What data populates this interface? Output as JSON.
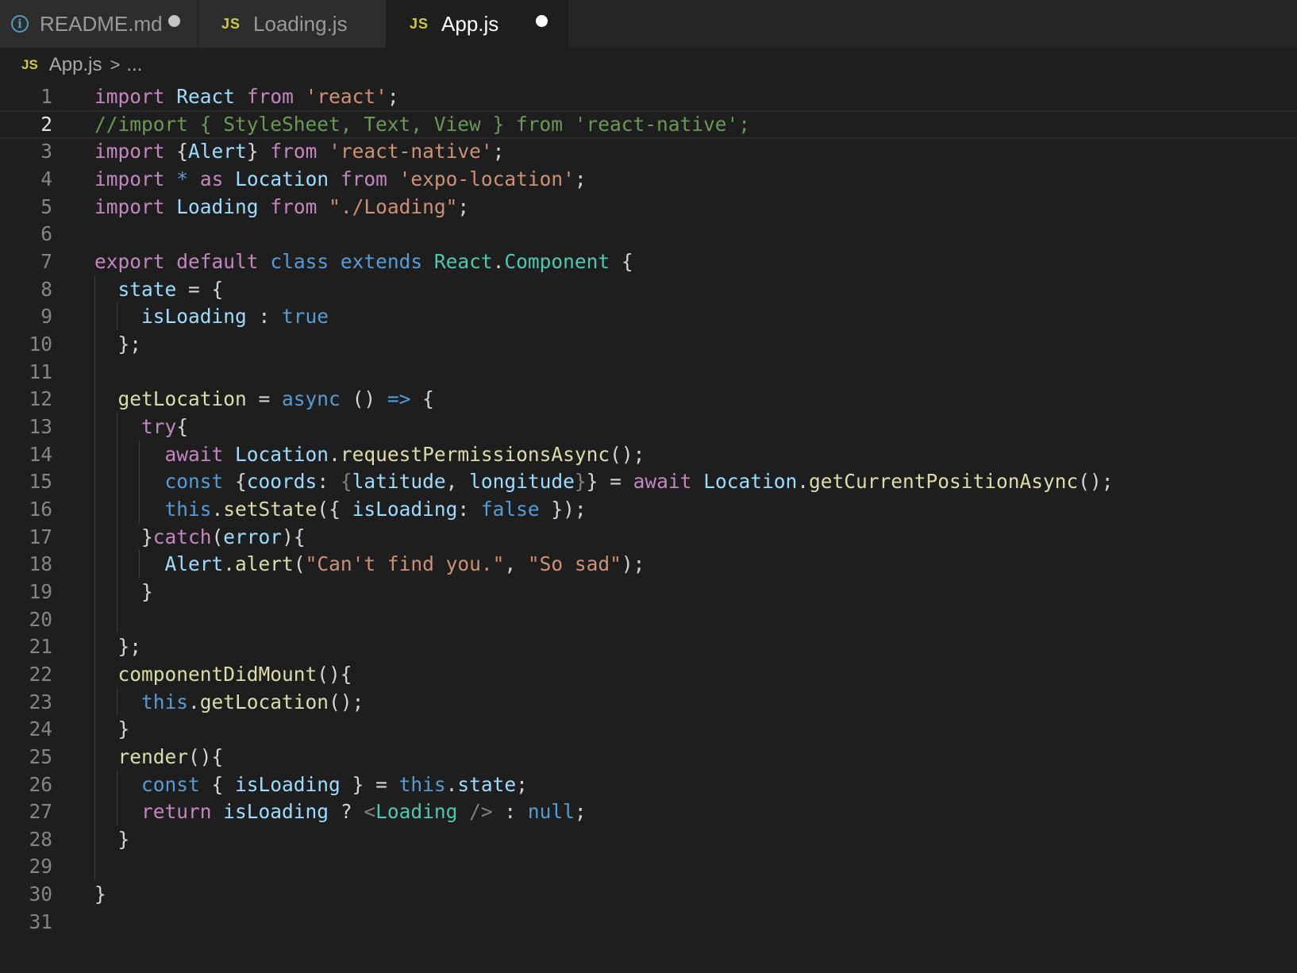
{
  "tabs": [
    {
      "label": "README.md",
      "icon": "info-icon",
      "dirty": true,
      "active": false
    },
    {
      "label": "Loading.js",
      "icon": "JS",
      "dirty": false,
      "active": false
    },
    {
      "label": "App.js",
      "icon": "JS",
      "dirty": true,
      "active": true
    }
  ],
  "breadcrumb": {
    "icon": "JS",
    "file": "App.js",
    "separator": ">",
    "rest": "..."
  },
  "editor": {
    "current_line": 2,
    "line_numbers": [
      "1",
      "2",
      "3",
      "4",
      "5",
      "6",
      "7",
      "8",
      "9",
      "10",
      "11",
      "12",
      "13",
      "14",
      "15",
      "16",
      "17",
      "18",
      "19",
      "20",
      "21",
      "22",
      "23",
      "24",
      "25",
      "26",
      "27",
      "28",
      "29",
      "30",
      "31"
    ],
    "lines": [
      [
        [
          "k",
          "import"
        ],
        [
          "p",
          " "
        ],
        [
          "v",
          "React"
        ],
        [
          "p",
          " "
        ],
        [
          "k",
          "from"
        ],
        [
          "p",
          " "
        ],
        [
          "s",
          "'react'"
        ],
        [
          "p",
          ";"
        ]
      ],
      [
        [
          "c",
          "//import { StyleSheet, Text, View } from 'react-native';"
        ]
      ],
      [
        [
          "k",
          "import"
        ],
        [
          "p",
          " {"
        ],
        [
          "v",
          "Alert"
        ],
        [
          "p",
          "} "
        ],
        [
          "k",
          "from"
        ],
        [
          "p",
          " "
        ],
        [
          "s",
          "'react-native'"
        ],
        [
          "p",
          ";"
        ]
      ],
      [
        [
          "k",
          "import"
        ],
        [
          "p",
          " "
        ],
        [
          "b",
          "*"
        ],
        [
          "p",
          " "
        ],
        [
          "k",
          "as"
        ],
        [
          "p",
          " "
        ],
        [
          "v",
          "Location"
        ],
        [
          "p",
          " "
        ],
        [
          "k",
          "from"
        ],
        [
          "p",
          " "
        ],
        [
          "s",
          "'expo-location'"
        ],
        [
          "p",
          ";"
        ]
      ],
      [
        [
          "k",
          "import"
        ],
        [
          "p",
          " "
        ],
        [
          "v",
          "Loading"
        ],
        [
          "p",
          " "
        ],
        [
          "k",
          "from"
        ],
        [
          "p",
          " "
        ],
        [
          "s",
          "\"./Loading\""
        ],
        [
          "p",
          ";"
        ]
      ],
      [],
      [
        [
          "k",
          "export"
        ],
        [
          "p",
          " "
        ],
        [
          "k",
          "default"
        ],
        [
          "p",
          " "
        ],
        [
          "b",
          "class"
        ],
        [
          "p",
          " "
        ],
        [
          "b",
          "extends"
        ],
        [
          "p",
          " "
        ],
        [
          "t",
          "React"
        ],
        [
          "p",
          "."
        ],
        [
          "t",
          "Component"
        ],
        [
          "p",
          " {"
        ]
      ],
      [
        [
          "p",
          "  "
        ],
        [
          "v",
          "state"
        ],
        [
          "p",
          " = {"
        ]
      ],
      [
        [
          "p",
          "    "
        ],
        [
          "v",
          "isLoading"
        ],
        [
          "p",
          " : "
        ],
        [
          "b",
          "true"
        ]
      ],
      [
        [
          "p",
          "  };"
        ]
      ],
      [],
      [
        [
          "p",
          "  "
        ],
        [
          "f",
          "getLocation"
        ],
        [
          "p",
          " = "
        ],
        [
          "b",
          "async"
        ],
        [
          "p",
          " () "
        ],
        [
          "b",
          "=>"
        ],
        [
          "p",
          " {"
        ]
      ],
      [
        [
          "p",
          "    "
        ],
        [
          "k",
          "try"
        ],
        [
          "p",
          "{"
        ]
      ],
      [
        [
          "p",
          "      "
        ],
        [
          "k",
          "await"
        ],
        [
          "p",
          " "
        ],
        [
          "v",
          "Location"
        ],
        [
          "p",
          "."
        ],
        [
          "f",
          "requestPermissionsAsync"
        ],
        [
          "p",
          "();"
        ]
      ],
      [
        [
          "p",
          "      "
        ],
        [
          "b",
          "const"
        ],
        [
          "p",
          " {"
        ],
        [
          "v",
          "coords"
        ],
        [
          "p",
          ": "
        ],
        [
          "g",
          "{"
        ],
        [
          "v",
          "latitude"
        ],
        [
          "p",
          ", "
        ],
        [
          "v",
          "longitude"
        ],
        [
          "g",
          "}"
        ],
        [
          "p",
          "} = "
        ],
        [
          "k",
          "await"
        ],
        [
          "p",
          " "
        ],
        [
          "v",
          "Location"
        ],
        [
          "p",
          "."
        ],
        [
          "f",
          "getCurrentPositionAsync"
        ],
        [
          "p",
          "();"
        ]
      ],
      [
        [
          "p",
          "      "
        ],
        [
          "b",
          "this"
        ],
        [
          "p",
          "."
        ],
        [
          "f",
          "setState"
        ],
        [
          "p",
          "({ "
        ],
        [
          "v",
          "isLoading"
        ],
        [
          "p",
          ": "
        ],
        [
          "b",
          "false"
        ],
        [
          "p",
          " });"
        ]
      ],
      [
        [
          "p",
          "    }"
        ],
        [
          "k",
          "catch"
        ],
        [
          "p",
          "("
        ],
        [
          "v",
          "error"
        ],
        [
          "p",
          "){"
        ]
      ],
      [
        [
          "p",
          "      "
        ],
        [
          "v",
          "Alert"
        ],
        [
          "p",
          "."
        ],
        [
          "f",
          "alert"
        ],
        [
          "p",
          "("
        ],
        [
          "s",
          "\"Can't find you.\""
        ],
        [
          "p",
          ", "
        ],
        [
          "s",
          "\"So sad\""
        ],
        [
          "p",
          ");"
        ]
      ],
      [
        [
          "p",
          "    }"
        ]
      ],
      [],
      [
        [
          "p",
          "  };"
        ]
      ],
      [
        [
          "p",
          "  "
        ],
        [
          "f",
          "componentDidMount"
        ],
        [
          "p",
          "(){"
        ]
      ],
      [
        [
          "p",
          "    "
        ],
        [
          "b",
          "this"
        ],
        [
          "p",
          "."
        ],
        [
          "f",
          "getLocation"
        ],
        [
          "p",
          "();"
        ]
      ],
      [
        [
          "p",
          "  }"
        ]
      ],
      [
        [
          "p",
          "  "
        ],
        [
          "f",
          "render"
        ],
        [
          "p",
          "(){"
        ]
      ],
      [
        [
          "p",
          "    "
        ],
        [
          "b",
          "const"
        ],
        [
          "p",
          " { "
        ],
        [
          "v",
          "isLoading"
        ],
        [
          "p",
          " } = "
        ],
        [
          "b",
          "this"
        ],
        [
          "p",
          "."
        ],
        [
          "v",
          "state"
        ],
        [
          "p",
          ";"
        ]
      ],
      [
        [
          "p",
          "    "
        ],
        [
          "k",
          "return"
        ],
        [
          "p",
          " "
        ],
        [
          "v",
          "isLoading"
        ],
        [
          "p",
          " ? "
        ],
        [
          "g",
          "<"
        ],
        [
          "t",
          "Loading"
        ],
        [
          "p",
          " "
        ],
        [
          "g",
          "/>"
        ],
        [
          "p",
          " : "
        ],
        [
          "b",
          "null"
        ],
        [
          "p",
          ";"
        ]
      ],
      [
        [
          "p",
          "  }"
        ]
      ],
      [],
      [
        [
          "p",
          "}"
        ]
      ],
      []
    ]
  },
  "colors": {
    "background": "#1e1e1e",
    "keyword": "#c586c0",
    "storage": "#569cd6",
    "variable": "#9cdcfe",
    "type": "#4ec9b0",
    "string": "#ce9178",
    "function": "#dcdcaa",
    "comment": "#6a9955",
    "js_icon": "#cbcb41"
  }
}
